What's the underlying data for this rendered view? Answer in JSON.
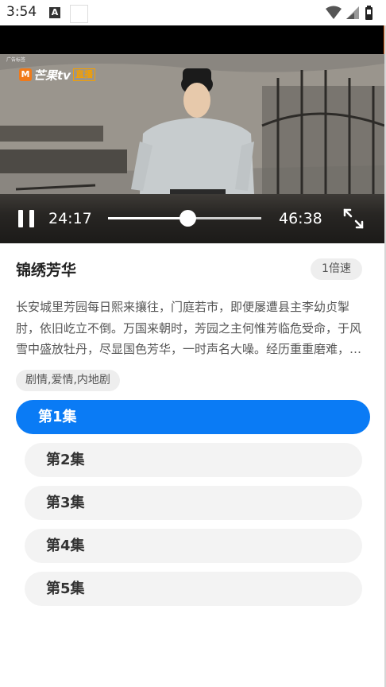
{
  "status_bar": {
    "time": "3:54",
    "notification_icon": "A"
  },
  "video": {
    "ad_tag": "广告标签",
    "logo": {
      "name": "芒果tv",
      "live_badge": "直播",
      "mark": "M"
    },
    "current_time": "24:17",
    "total_time": "46:38",
    "progress": 0.52
  },
  "info": {
    "title": "锦绣芳华",
    "speed_label": "1倍速",
    "description": "长安城里芳园每日熙来攘往，门庭若市，即便屡遭县主李幼贞掣肘，依旧屹立不倒。万国来朝时，芳园之主何惟芳临危受命，于风雪中盛放牡丹，尽显国色芳华，一时声名大噪。经历重重磨难，何惟芳与蒋长扬情投意合，携手共度。",
    "genre": "剧情,爱情,内地剧"
  },
  "episodes": [
    {
      "label": "第1集",
      "active": true
    },
    {
      "label": "第2集",
      "active": false
    },
    {
      "label": "第3集",
      "active": false
    },
    {
      "label": "第4集",
      "active": false
    },
    {
      "label": "第5集",
      "active": false
    }
  ],
  "colors": {
    "accent": "#0a7bf5",
    "episode_inactive_bg": "#f3f3f3",
    "logo_orange": "#f07a1a"
  },
  "icons": {
    "pause": "pause-icon",
    "fullscreen": "expand-icon",
    "wifi": "wifi-icon",
    "signal": "signal-icon",
    "battery": "battery-icon"
  }
}
